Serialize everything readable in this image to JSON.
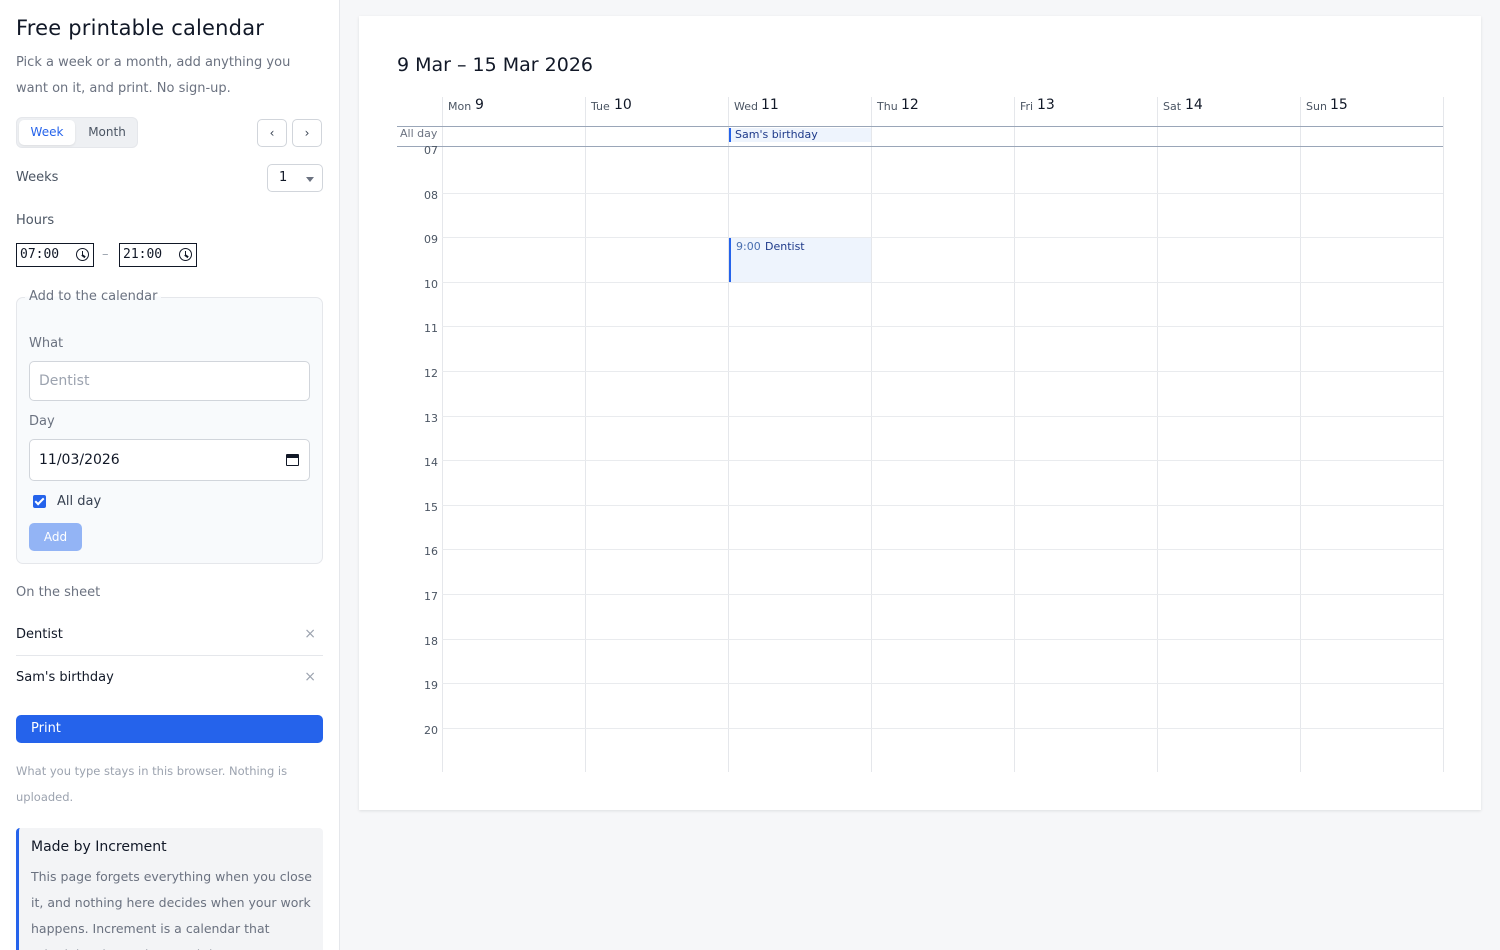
{
  "sidebar": {
    "title": "Free printable calendar",
    "subtitle": "Pick a week or a month, add anything you want on it, and print. No sign-up.",
    "view_toggle": {
      "week": "Week",
      "month": "Month",
      "selected": "Week"
    },
    "nav": {
      "prev": "‹",
      "next": "›"
    },
    "weeks": {
      "label": "Weeks",
      "value": "1"
    },
    "hours": {
      "label": "Hours",
      "from": "07:00",
      "separator": "–",
      "to": "21:00"
    },
    "add_form": {
      "legend": "Add to the calendar",
      "what_label": "What",
      "what_placeholder": "Dentist",
      "day_label": "Day",
      "day_value": "11/03/2026",
      "all_day_label": "All day",
      "all_day_checked": true,
      "add_button": "Add"
    },
    "on_sheet": {
      "label": "On the sheet",
      "items": [
        {
          "name": "Dentist",
          "remove": "×"
        },
        {
          "name": "Sam's birthday",
          "remove": "×"
        }
      ]
    },
    "print_button": "Print",
    "privacy_note": "What you type stays in this browser. Nothing is uploaded.",
    "promo": {
      "title": "Made by Increment",
      "text": "This page forgets everything when you close it, and nothing here decides when your work happens. Increment is a calendar that schedules the work around the..."
    }
  },
  "calendar": {
    "range_title": "9 Mar – 15 Mar 2026",
    "days": [
      {
        "name": "Mon",
        "date": "9"
      },
      {
        "name": "Tue",
        "date": "10"
      },
      {
        "name": "Wed",
        "date": "11"
      },
      {
        "name": "Thu",
        "date": "12"
      },
      {
        "name": "Fri",
        "date": "13"
      },
      {
        "name": "Sat",
        "date": "14"
      },
      {
        "name": "Sun",
        "date": "15"
      }
    ],
    "all_day_label": "All day",
    "all_day_events": [
      {
        "day": "Wed 11",
        "title": "Sam's birthday"
      }
    ],
    "hours": [
      "07",
      "08",
      "09",
      "10",
      "11",
      "12",
      "13",
      "14",
      "15",
      "16",
      "17",
      "18",
      "19",
      "20"
    ],
    "timed_events": [
      {
        "day": "Wed 11",
        "time": "9:00",
        "title": "Dentist"
      }
    ]
  },
  "colors": {
    "accent": "#2563eb",
    "accent_disabled": "#93b4f5",
    "event_bg": "#eef4fd",
    "page_bg": "#f6f7f9"
  }
}
